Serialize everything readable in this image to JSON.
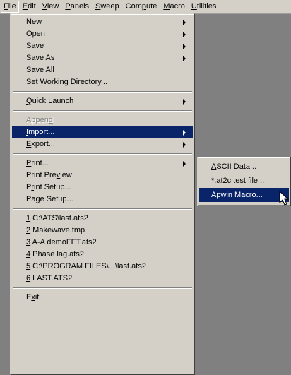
{
  "menubar": {
    "items": [
      {
        "id": "file",
        "pre": "",
        "key": "F",
        "post": "ile"
      },
      {
        "id": "edit",
        "pre": "",
        "key": "E",
        "post": "dit"
      },
      {
        "id": "view",
        "pre": "",
        "key": "V",
        "post": "iew"
      },
      {
        "id": "panels",
        "pre": "",
        "key": "P",
        "post": "anels"
      },
      {
        "id": "sweep",
        "pre": "",
        "key": "S",
        "post": "weep"
      },
      {
        "id": "compute",
        "pre": "Com",
        "key": "p",
        "post": "ute"
      },
      {
        "id": "macro",
        "pre": "",
        "key": "M",
        "post": "acro"
      },
      {
        "id": "utilities",
        "pre": "",
        "key": "U",
        "post": "tilities"
      }
    ]
  },
  "file_menu": {
    "new": {
      "pre": "",
      "key": "N",
      "post": "ew"
    },
    "open": {
      "pre": "",
      "key": "O",
      "post": "pen"
    },
    "save": {
      "pre": "",
      "key": "S",
      "post": "ave"
    },
    "save_as": {
      "pre": "Save ",
      "key": "A",
      "post": "s"
    },
    "save_all": {
      "pre": "Save A",
      "key": "l",
      "post": "l"
    },
    "set_dir": {
      "pre": "Se",
      "key": "t",
      "post": " Working Directory..."
    },
    "quick_launch": {
      "pre": "",
      "key": "Q",
      "post": "uick Launch"
    },
    "append": {
      "pre": "Appen",
      "key": "d",
      "post": ""
    },
    "import": {
      "pre": "",
      "key": "I",
      "post": "mport..."
    },
    "export": {
      "pre": "",
      "key": "E",
      "post": "xport..."
    },
    "print": {
      "pre": "",
      "key": "P",
      "post": "rint..."
    },
    "print_preview": {
      "pre": "Print Pre",
      "key": "v",
      "post": "iew"
    },
    "print_setup": {
      "pre": "P",
      "key": "r",
      "post": "int Setup..."
    },
    "page_setup": {
      "pre": "Pa",
      "key": "g",
      "post": "e Setup..."
    },
    "recent": [
      {
        "key": "1",
        "post": " C:\\ATS\\last.ats2"
      },
      {
        "key": "2",
        "post": " Makewave.tmp"
      },
      {
        "key": "3",
        "post": " A-A demoFFT.ats2"
      },
      {
        "key": "4",
        "post": " Phase lag.ats2"
      },
      {
        "key": "5",
        "post": " C:\\PROGRAM FILES\\...\\last.ats2"
      },
      {
        "key": "6",
        "post": " LAST.ATS2"
      }
    ],
    "exit": {
      "pre": "E",
      "key": "x",
      "post": "it"
    }
  },
  "import_submenu": {
    "ascii": {
      "pre": "",
      "key": "A",
      "post": "SCII Data..."
    },
    "at2c": {
      "pre": "*.at2c test file...",
      "key": "",
      "post": ""
    },
    "apwin": {
      "pre": "Apwin Macro...",
      "key": "",
      "post": ""
    }
  },
  "colors": {
    "menu_face": "#d4d0c8",
    "highlight": "#0a246a",
    "workspace": "#808080"
  }
}
